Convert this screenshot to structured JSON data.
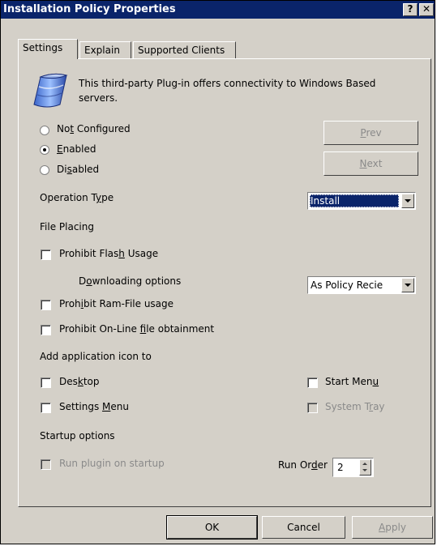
{
  "window": {
    "title": "Installation Policy Properties",
    "help_glyph": "?",
    "close_glyph": "✕"
  },
  "tabs": [
    {
      "label": "Settings",
      "active": true
    },
    {
      "label": "Explain",
      "active": false
    },
    {
      "label": "Supported Clients",
      "active": false
    }
  ],
  "info": {
    "icon": "plugin-server-icon",
    "text_line1": "This third-party Plug-in offers connectivity to Windows Based",
    "text_line2": "servers."
  },
  "radios": [
    {
      "pre": "No",
      "key": "t",
      "post": " Configured",
      "checked": false
    },
    {
      "pre": "",
      "key": "E",
      "post": "nabled",
      "checked": true
    },
    {
      "pre": "Di",
      "key": "s",
      "post": "abled",
      "checked": false
    }
  ],
  "nav": {
    "prev_pre": "",
    "prev_key": "P",
    "prev_post": "rev",
    "next_pre": "",
    "next_key": "N",
    "next_post": "ext"
  },
  "operation": {
    "label_pre": "Operation T",
    "label_key": "y",
    "label_post": "pe",
    "value": "Install"
  },
  "file_placing": {
    "heading": "File Placing",
    "flash_pre": "Prohibit Flas",
    "flash_key": "h",
    "flash_post": " Usage",
    "dl_pre": "D",
    "dl_key": "o",
    "dl_post": "wnloading options",
    "dl_value": "As Policy Recie",
    "ram_pre": "Proh",
    "ram_key": "i",
    "ram_post": "bit Ram-File usage",
    "online_pre": "Prohibit On-Line ",
    "online_key": "f",
    "online_post": "ile obtainment"
  },
  "app_icon": {
    "heading": "Add application icon to",
    "desktop_pre": "Des",
    "desktop_key": "k",
    "desktop_post": "top",
    "start_pre": "Start Men",
    "start_key": "u",
    "start_post": "",
    "settings_pre": "Settings ",
    "settings_key": "M",
    "settings_post": "enu",
    "tray_pre": "System T",
    "tray_key": "r",
    "tray_post": "ay"
  },
  "startup": {
    "heading": "Startup options",
    "run_plugin": "Run plugin on startup",
    "order_pre": "Run Or",
    "order_key": "d",
    "order_post": "er",
    "order_value": "2"
  },
  "buttons": {
    "ok": "OK",
    "cancel": "Cancel",
    "apply_key": "A",
    "apply_post": "pply"
  },
  "colors": {
    "title_bar": "#0a246a",
    "face": "#d4d0c8",
    "selection": "#0a246a"
  }
}
